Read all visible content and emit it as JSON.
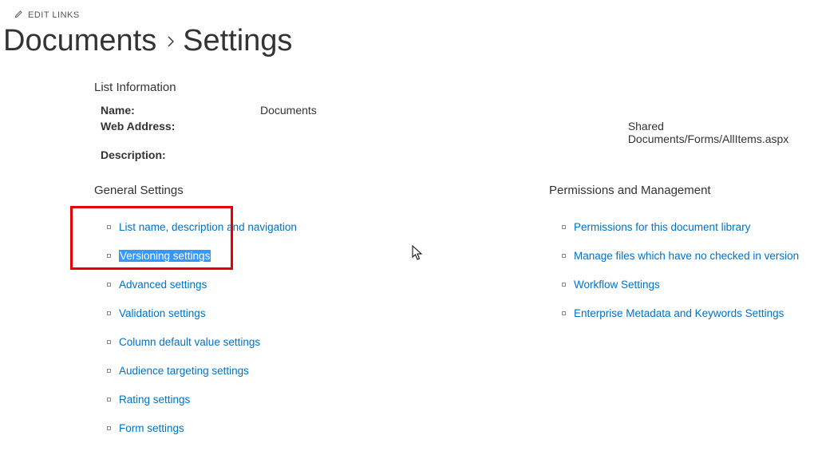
{
  "editLinks": "EDIT LINKS",
  "breadcrumb": {
    "parent": "Documents",
    "current": "Settings"
  },
  "listInfo": {
    "heading": "List Information",
    "nameLabel": "Name:",
    "nameValue": "Documents",
    "addressLabel": "Web Address:",
    "addressValue": "Shared Documents/Forms/AllItems.aspx",
    "descriptionLabel": "Description:"
  },
  "general": {
    "heading": "General Settings",
    "links": [
      "List name, description and navigation",
      "Versioning settings",
      "Advanced settings",
      "Validation settings",
      "Column default value settings",
      "Audience targeting settings",
      "Rating settings",
      "Form settings"
    ]
  },
  "permissions": {
    "heading": "Permissions and Management",
    "links": [
      "Permissions for this document library",
      "Manage files which have no checked in version",
      "Workflow Settings",
      "Enterprise Metadata and Keywords Settings"
    ]
  }
}
